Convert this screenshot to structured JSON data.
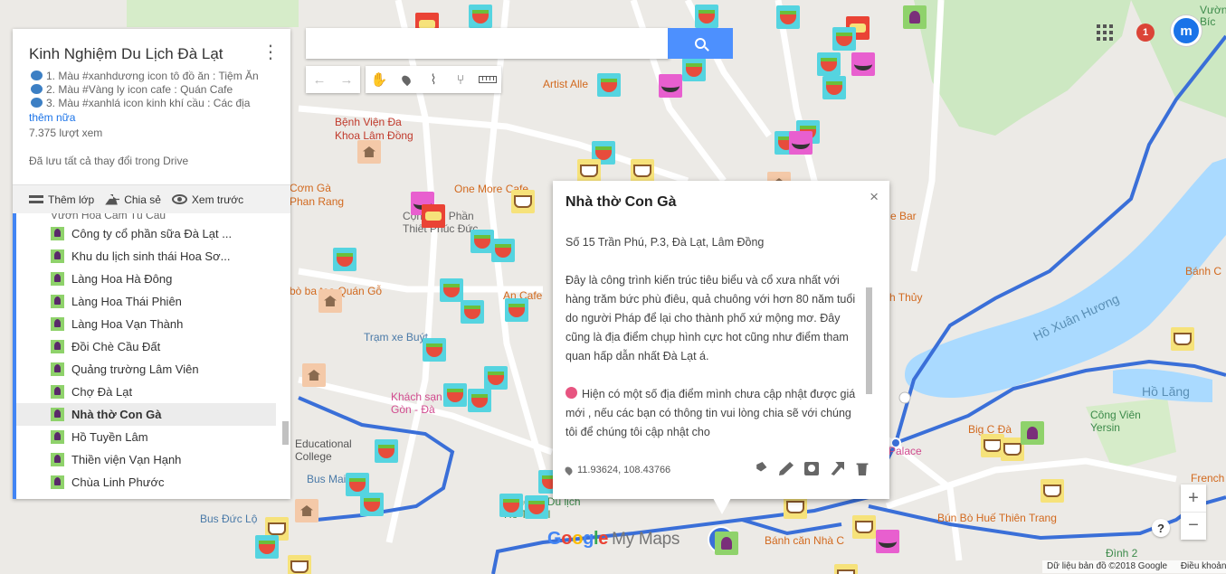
{
  "panel": {
    "title": "Kinh Nghiệm Du Lịch Đà Lạt",
    "legend": [
      "1. Màu #xanhdương icon tô đồ ăn : Tiệm Ăn",
      "2. Màu #Vàng ly icon cafe : Quán Cafe",
      "3. Màu #xanhlá icon kinh khí cầu : Các địa"
    ],
    "more_link": "thêm nữa",
    "views": "7.375 lượt xem",
    "saved": "Đã lưu tất cả thay đổi trong Drive",
    "tools": {
      "add_layer": "Thêm lớp",
      "share": "Chia sẻ",
      "preview": "Xem trước"
    },
    "list_partial": "Vườn Hoa Cẩm Tú Cầu",
    "list": [
      "Công ty cổ phần sữa Đà Lạt ...",
      "Khu du lịch sinh thái Hoa Sơ...",
      "Làng Hoa Hà Đông",
      "Làng Hoa Thái Phiên",
      "Làng Hoa Vạn Thành",
      "Đồi Chè Cầu Đất",
      "Quảng trường Lâm Viên",
      "Chợ Đà Lạt",
      "Nhà thờ Con Gà",
      "Hồ Tuyền Lâm",
      "Thiền viện Vạn Hạnh",
      "Chùa Linh Phước"
    ],
    "selected_index": 8
  },
  "search": {
    "value": "",
    "placeholder": ""
  },
  "info": {
    "title": "Nhà thờ Con Gà",
    "close": "×",
    "address": "Số 15 Trần Phú, P.3, Đà Lạt, Lâm Đồng",
    "description": "Đây là công trình kiến trúc tiêu biểu và cổ xưa nhất với hàng trăm bức phù điêu, quả chuông với hơn 80 năm tuổi do người Pháp để lại cho thành phố xứ mộng mơ. Đây cũng là địa điểm chụp hình cực hot cũng như điểm tham quan hấp dẫn nhất Đà Lạt á.",
    "note": "Hiện có một số địa điểm mình chưa cập nhật được giá mới , nếu các bạn có thông tin vui lòng chia sẽ với chúng tôi để chúng tôi cập nhật cho",
    "coords": "11.93624, 108.43766"
  },
  "top_right": {
    "notification_count": "1",
    "account_letter": "m"
  },
  "zoom": {
    "in": "+",
    "out": "−"
  },
  "help": "?",
  "footer": {
    "data": "Dữ liệu bản đồ ©2018 Google",
    "terms": "Điều khoản"
  },
  "brand": {
    "google": "Google",
    "my_maps": "My Maps"
  },
  "map_labels": {
    "artist": "Artist Alle",
    "hospital": "Bệnh Viện Đa\nKhoa Lâm Đồng",
    "one_more_cafe": "One More Cafe",
    "com_phan_rang": "Cơm Gà\nPhan Rang",
    "cong_phan": "Cộng Cổ Phần\nThiết Phúc Đức",
    "bo_ba_toa": "bò ba toa Quán Gỗ",
    "tram_xe": "Trạm xe Buýt",
    "khach_san": "Khách sạn\nGòn - Đà",
    "educational": "Educational\nCollege",
    "bus_mai": "Bus Mai",
    "bus_duc_long": "Bus Đức Lộ",
    "cong_ty_du_lich": "Công Ty Du lịch\nHo Travel",
    "ho_xuan_huong": "Hồ Xuân Hương",
    "ho_lang": "Hồ Lăng",
    "cong_vien": "Công Viên\nYersin",
    "big_c": "Big C Đà",
    "palace": "Palace",
    "bun_bo": "Bún Bò Huế Thiên Trang",
    "banh_can": "Bánh căn Nhà C",
    "french": "French",
    "banh_c": "Bánh C",
    "thuy": "h Thủy",
    "bar": "e Bar",
    "vuon_bic": "Vườn\nBíc",
    "an_cafe": "An Cafe",
    "dinh_2": "Đình 2"
  }
}
